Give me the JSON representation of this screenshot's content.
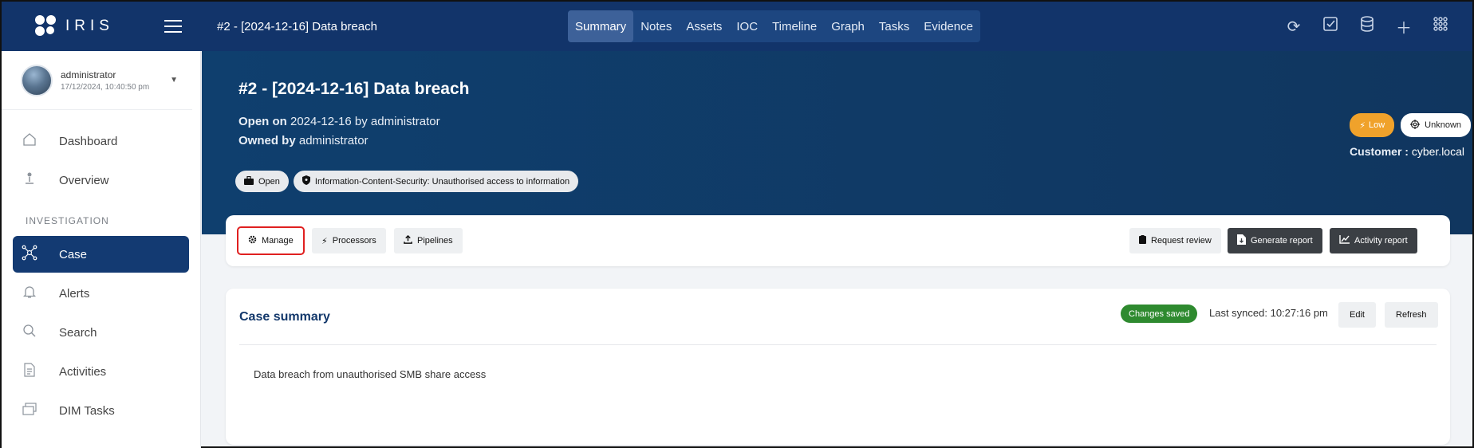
{
  "brand": {
    "name": "IRIS"
  },
  "topbar": {
    "case_title": "#2 - [2024-12-16] Data breach",
    "tabs": [
      {
        "label": "Summary"
      },
      {
        "label": "Notes"
      },
      {
        "label": "Assets"
      },
      {
        "label": "IOC"
      },
      {
        "label": "Timeline"
      },
      {
        "label": "Graph"
      },
      {
        "label": "Tasks"
      },
      {
        "label": "Evidence"
      }
    ],
    "icons": [
      "refresh-icon",
      "checkbox-icon",
      "database-icon",
      "plus-icon",
      "apps-grid-icon"
    ]
  },
  "user": {
    "name": "administrator",
    "timestamp": "17/12/2024, 10:40:50 pm"
  },
  "sidebar": {
    "items": [
      {
        "label": "Dashboard",
        "icon": "home-icon"
      },
      {
        "label": "Overview",
        "icon": "person-pin-icon"
      }
    ],
    "section": "INVESTIGATION",
    "investigation_items": [
      {
        "label": "Case",
        "icon": "graph-nodes-icon"
      },
      {
        "label": "Alerts",
        "icon": "bell-icon"
      },
      {
        "label": "Search",
        "icon": "search-icon"
      },
      {
        "label": "Activities",
        "icon": "document-icon"
      },
      {
        "label": "DIM Tasks",
        "icon": "windows-icon"
      }
    ]
  },
  "hero": {
    "title": "#2 - [2024-12-16] Data breach",
    "open_on_label": "Open on",
    "open_on_value": "2024-12-16 by administrator",
    "owned_by_label": "Owned by",
    "owned_by_value": "administrator",
    "chips": [
      {
        "label": "Open",
        "icon": "briefcase-icon"
      },
      {
        "label": "Information-Content-Security: Unauthorised access to information",
        "icon": "shield-icon"
      }
    ],
    "severity": "Low",
    "outcome": "Unknown",
    "customer_label": "Customer :",
    "customer_value": "cyber.local"
  },
  "toolbar": {
    "manage": "Manage",
    "processors": "Processors",
    "pipelines": "Pipelines",
    "request_review": "Request review",
    "generate_report": "Generate report",
    "activity_report": "Activity report"
  },
  "summary": {
    "title": "Case summary",
    "status": "Changes saved",
    "last_synced": "Last synced: 10:27:16 pm",
    "edit": "Edit",
    "refresh": "Refresh",
    "text": "Data breach from unauthorised SMB share access"
  },
  "colors": {
    "navbar": "#12346a",
    "active_nav": "#133a72",
    "severity_low": "#f0a22b",
    "saved_badge": "#2e8a2f",
    "highlight_outline": "#e02020"
  }
}
